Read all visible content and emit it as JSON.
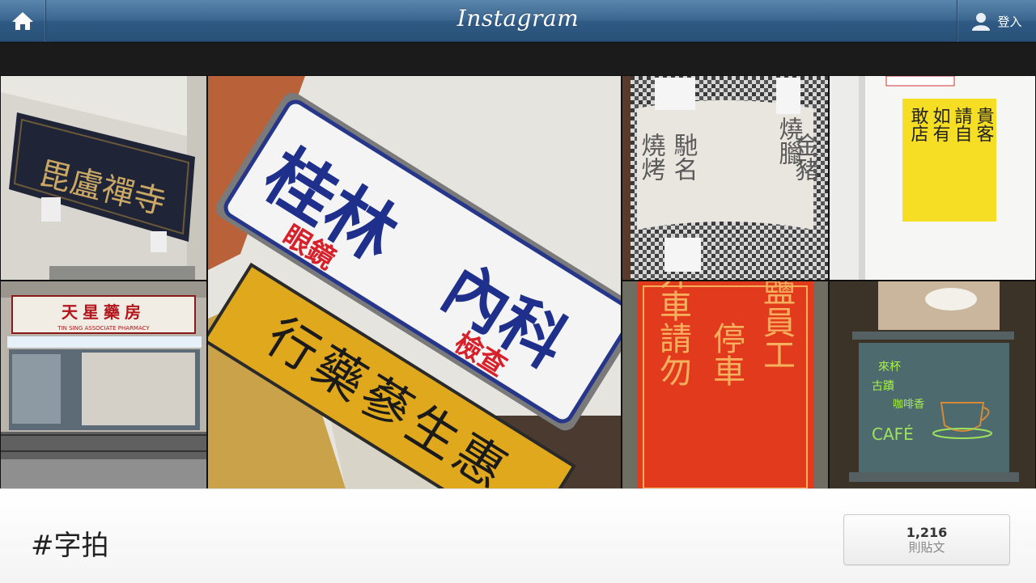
{
  "header": {
    "logo": "Instagram",
    "login_label": "登入",
    "home_icon": "home-icon",
    "user_icon": "user-icon"
  },
  "photos": [
    {
      "id": "temple-plaque",
      "text": "毘盧禪寺"
    },
    {
      "id": "eyewear-sign",
      "text_main": "桂林",
      "text_sub1": "眼鏡",
      "text_inner": "內科",
      "text_sub2": "檢查"
    },
    {
      "id": "bbq-pillar",
      "text_a": "燒臘",
      "text_b": "馳名",
      "text_c": "金豬",
      "text_d": "燒烤"
    },
    {
      "id": "notice-board",
      "lines": [
        "貴客",
        "請自",
        "如有",
        "敢店"
      ]
    },
    {
      "id": "pharmacy-storefront",
      "shop_name": "天星藥房",
      "romanized": "TIN SING ASSOCIATE PHARMACY"
    },
    {
      "id": "shop-sign-yellow",
      "text": "行藥蔘生惠"
    },
    {
      "id": "red-parking-sign",
      "col1": "外車請勿",
      "col2": "停車",
      "col3": "台鹽員工"
    },
    {
      "id": "cafe-window",
      "text_a": "來杯",
      "text_b": "古蹟",
      "text_c": "咖啡香",
      "text_d": "CAFÉ"
    }
  ],
  "tag": {
    "title": "#字拍",
    "post_count": "1,216",
    "post_label": "則貼文"
  },
  "colors": {
    "topbar": "#3b6690",
    "footer": "#f7f7f7"
  }
}
